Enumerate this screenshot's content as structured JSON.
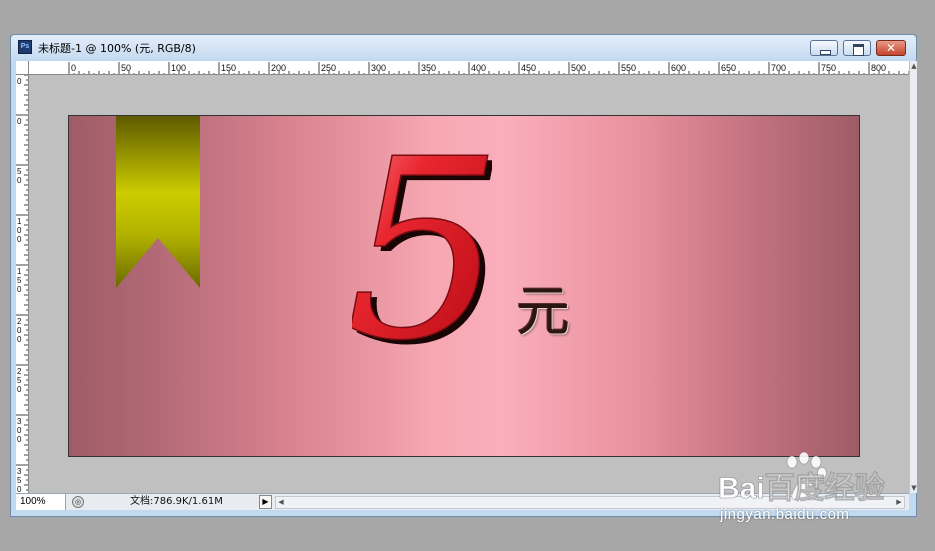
{
  "window": {
    "title": "未标题-1 @ 100% (元, RGB/8)",
    "app_icon": "photoshop-icon",
    "controls": {
      "minimize": "minimize-icon",
      "maximize": "maximize-icon",
      "close": "close-icon"
    }
  },
  "rulers": {
    "horizontal_labels": [
      "0",
      "50",
      "100",
      "150",
      "200",
      "250",
      "300",
      "350",
      "400",
      "450",
      "500",
      "550",
      "600",
      "650",
      "700",
      "750",
      "800"
    ],
    "vertical_labels": [
      "0",
      "0",
      "5\n0",
      "1\n0\n0",
      "1\n5\n0",
      "2\n0\n0",
      "2\n5\n0",
      "3\n0\n0",
      "3\n5\n0"
    ]
  },
  "canvas": {
    "numeral": "5",
    "currency_char": "元",
    "colors": {
      "background_edge": "#9f5c66",
      "background_center": "#faaebb",
      "ribbon_dark": "#666600",
      "ribbon_light": "#cccc00",
      "numeral_red": "#e02a33"
    }
  },
  "statusbar": {
    "zoom": "100%",
    "doc_info": "文档:786.9K/1.61M",
    "nav_icon": "play-triangle-icon"
  },
  "watermark": {
    "brand": "Bai百度经验",
    "url": "jingyan.baidu.com"
  }
}
